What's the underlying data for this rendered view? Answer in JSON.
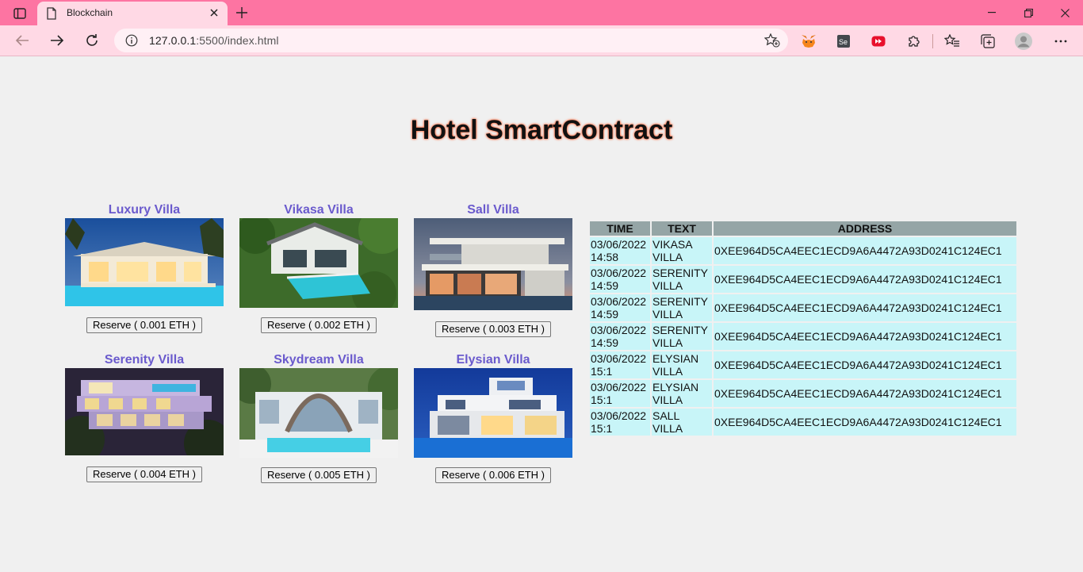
{
  "browser": {
    "tab_title": "Blockchain",
    "url_host": "127.0.0.1",
    "url_rest": ":5500/index.html",
    "accent": "#fd74a2",
    "toolbar_bg": "#ffd9e5"
  },
  "page": {
    "title": "Hotel SmartContract"
  },
  "villas": [
    {
      "name": "Luxury Villa",
      "button": "Reserve ( 0.001 ETH )"
    },
    {
      "name": "Vikasa Villa",
      "button": "Reserve ( 0.002 ETH )"
    },
    {
      "name": "Sall Villa",
      "button": "Reserve ( 0.003 ETH )"
    },
    {
      "name": "Serenity Villa",
      "button": "Reserve ( 0.004 ETH )"
    },
    {
      "name": "Skydream Villa",
      "button": "Reserve ( 0.005 ETH )"
    },
    {
      "name": "Elysian Villa",
      "button": "Reserve ( 0.006 ETH )"
    }
  ],
  "table": {
    "headers": {
      "time": "TIME",
      "text": "TEXT",
      "address": "ADDRESS"
    },
    "rows": [
      {
        "date": "03/06/2022",
        "time": "14:58",
        "villa1": "VIKASA",
        "villa2": "VILLA",
        "address": "0XEE964D5CA4EEC1ECD9A6A4472A93D0241C124EC1"
      },
      {
        "date": "03/06/2022",
        "time": "14:59",
        "villa1": "SERENITY",
        "villa2": "VILLA",
        "address": "0XEE964D5CA4EEC1ECD9A6A4472A93D0241C124EC1"
      },
      {
        "date": "03/06/2022",
        "time": "14:59",
        "villa1": "SERENITY",
        "villa2": "VILLA",
        "address": "0XEE964D5CA4EEC1ECD9A6A4472A93D0241C124EC1"
      },
      {
        "date": "03/06/2022",
        "time": "14:59",
        "villa1": "SERENITY",
        "villa2": "VILLA",
        "address": "0XEE964D5CA4EEC1ECD9A6A4472A93D0241C124EC1"
      },
      {
        "date": "03/06/2022",
        "time": "15:1",
        "villa1": "ELYSIAN",
        "villa2": "VILLA",
        "address": "0XEE964D5CA4EEC1ECD9A6A4472A93D0241C124EC1"
      },
      {
        "date": "03/06/2022",
        "time": "15:1",
        "villa1": "ELYSIAN",
        "villa2": "VILLA",
        "address": "0XEE964D5CA4EEC1ECD9A6A4472A93D0241C124EC1"
      },
      {
        "date": "03/06/2022",
        "time": "15:1",
        "villa1": "SALL",
        "villa2": "VILLA",
        "address": "0XEE964D5CA4EEC1ECD9A6A4472A93D0241C124EC1"
      }
    ]
  }
}
